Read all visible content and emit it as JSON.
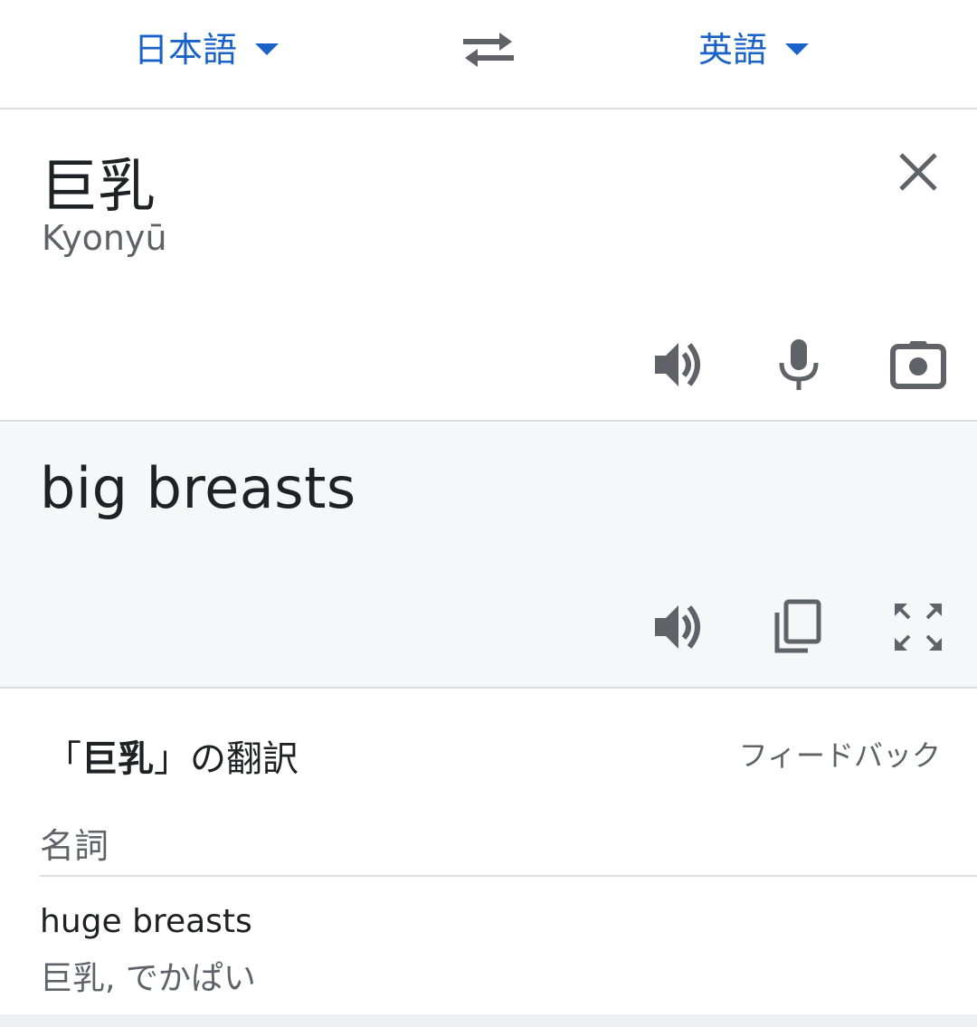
{
  "languages": {
    "source": "日本語",
    "target": "英語"
  },
  "source": {
    "text": "巨乳",
    "romanization": "Kyonyū"
  },
  "translation": {
    "text": "big breasts"
  },
  "dictionary": {
    "title_prefix": "「",
    "title_term": "巨乳",
    "title_suffix": "」の翻訳",
    "feedback": "フィードバック",
    "part_of_speech": "名詞",
    "entries": [
      {
        "word": "huge breasts",
        "synonyms": "巨乳, でかぱい"
      }
    ]
  },
  "colors": {
    "accent": "#1a62c8",
    "icon": "#5f6368",
    "panel_bg": "#f6f7f9"
  },
  "icons": {
    "swap": "swap-arrows-icon",
    "clear": "close-icon",
    "speaker": "speaker-icon",
    "mic": "microphone-icon",
    "camera": "camera-icon",
    "copy": "copy-icon",
    "fullscreen": "fullscreen-icon"
  }
}
